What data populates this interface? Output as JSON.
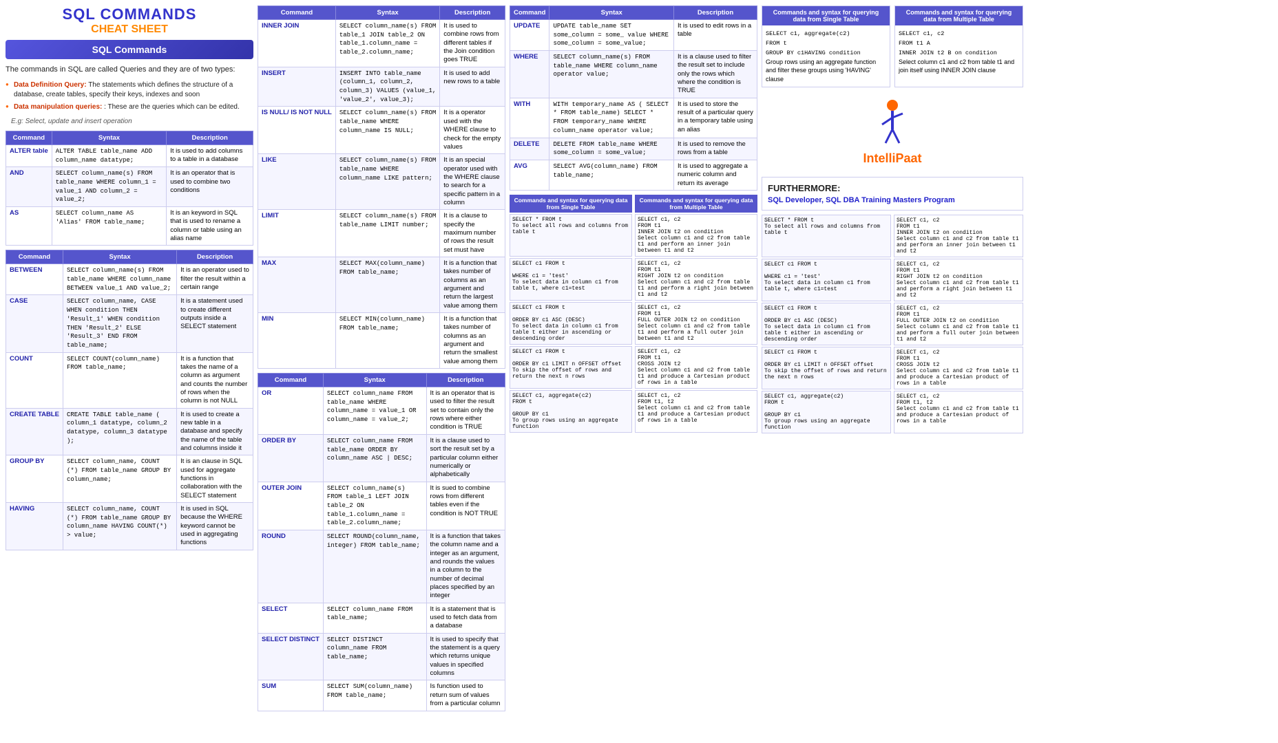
{
  "title": {
    "main": "SQL COMMANDS",
    "sub": "CHEAT SHEET",
    "commands_label": "SQL Commands"
  },
  "intro": {
    "text": "The commands in SQL are called Queries and they are of two types:",
    "bullets": [
      {
        "label": "Data Definition Query:",
        "text": " The statements which defines the structure of a database, create tables, specify their keys, indexes and soon"
      },
      {
        "label": "Data manipulation queries:",
        "text": " : These are the queries which can be edited."
      }
    ],
    "eg": "E.g: Select, update and insert operation"
  },
  "table1": {
    "headers": [
      "Command",
      "Syntax",
      "Description"
    ],
    "rows": [
      {
        "command": "ALTER table",
        "syntax": "ALTER TABLE table_name ADD column_name datatype;",
        "description": "It is used to add columns to a table in a database"
      },
      {
        "command": "AND",
        "syntax": "SELECT column_name(s) FROM table_name WHERE column_1 = value_1 AND column_2 = value_2;",
        "description": "It is an operator that is used to combine two conditions"
      },
      {
        "command": "AS",
        "syntax": "SELECT column_name AS 'Alias' FROM table_name;",
        "description": "It is an keyword in SQL that is used to rename a column or table using an alias name"
      }
    ]
  },
  "table2": {
    "headers": [
      "Command",
      "Syntax",
      "Description"
    ],
    "rows": [
      {
        "command": "BETWEEN",
        "syntax": "SELECT column_name(s) FROM table_name WHERE column_name BETWEEN value_1 AND value_2;",
        "description": "It is an operator used to filter the result within a certain range"
      },
      {
        "command": "CASE",
        "syntax": "SELECT column_name, CASE WHEN condition THEN 'Result_1' WHEN condition THEN 'Result_2' ELSE 'Result_3' END FROM table_name;",
        "description": "It is a statement used to create different outputs inside a SELECT statement"
      },
      {
        "command": "COUNT",
        "syntax": "SELECT COUNT(column_name) FROM table_name;",
        "description": "It is a function that takes the name of a column as argument and counts the number of rows when the column is not NULL"
      },
      {
        "command": "CREATE TABLE",
        "syntax": "CREATE TABLE table_name ( column_1 datatype, column_2 datatype, column_3 datatype );",
        "description": "It is used to create a new table in a database and specify the name of the table and columns inside it"
      },
      {
        "command": "GROUP BY",
        "syntax": "SELECT column_name, COUNT (*) FROM table_name GROUP BY column_name;",
        "description": "It is an clause in SQL used for aggregate functions in collaboration with the SELECT statement"
      },
      {
        "command": "HAVING",
        "syntax": "SELECT column_name, COUNT (*) FROM table_name GROUP BY column_name HAVING COUNT(*) > value;",
        "description": "It is used in SQL because the WHERE keyword cannot be used in aggregating functions"
      }
    ]
  },
  "table3": {
    "headers": [
      "Command",
      "Syntax",
      "Description"
    ],
    "rows": [
      {
        "command": "INNER JOIN",
        "syntax": "SELECT column_name(s) FROM table_1 JOIN table_2 ON table_1.column_name = table_2.column_name;",
        "description": "It is used to combine rows from different tables if the Join condition goes TRUE"
      },
      {
        "command": "INSERT",
        "syntax": "INSERT INTO table_name (column_1, column_2, column_3) VALUES (value_1, 'value_2', value_3);",
        "description": "It is used to add new rows to a table"
      },
      {
        "command": "IS NULL/ IS NOT NULL",
        "syntax": "SELECT column_name(s) FROM table_name WHERE column_name IS NULL;",
        "description": "It is a operator used with the WHERE clause to check for the empty values"
      },
      {
        "command": "LIKE",
        "syntax": "SELECT column_name(s) FROM table_name WHERE column_name LIKE pattern;",
        "description": "It is an special operator used with the WHERE clause to search for a specific pattern in a column"
      },
      {
        "command": "LIMIT",
        "syntax": "SELECT column_name(s) FROM table_name LIMIT number;",
        "description": "It is a clause to specify the maximum number of rows the result set must have"
      },
      {
        "command": "MAX",
        "syntax": "SELECT MAX(column_name) FROM table_name;",
        "description": "It is a function that takes number of columns as an argument and return the largest value among them"
      },
      {
        "command": "MIN",
        "syntax": "SELECT MIN(column_name) FROM table_name;",
        "description": "It is a function that takes number of columns as an argument and return the smallest value among them"
      }
    ]
  },
  "table4": {
    "headers": [
      "Command",
      "Syntax",
      "Description"
    ],
    "rows": [
      {
        "command": "OR",
        "syntax": "SELECT column_name FROM table_name WHERE column_name = value_1 OR column_name = value_2;",
        "description": "It is an operator that is used to filter the result set to contain only the rows where either condition is TRUE"
      },
      {
        "command": "ORDER BY",
        "syntax": "SELECT column_name FROM table_name ORDER BY column_name ASC | DESC;",
        "description": "It is a clause used to sort the result set by a particular column either numerically or alphabetically"
      },
      {
        "command": "OUTER JOIN",
        "syntax": "SELECT column_name(s) FROM table_1 LEFT JOIN table_2 ON table_1.column_name = table_2.column_name;",
        "description": "It is sued to combine rows from different tables even if the condition is NOT TRUE"
      },
      {
        "command": "ROUND",
        "syntax": "SELECT ROUND(column_name, integer) FROM table_name;",
        "description": "It is a function that takes the column name and a integer as an argument, and rounds the values in a column to the number of decimal places specified by an integer"
      },
      {
        "command": "SELECT",
        "syntax": "SELECT column_name FROM table_name;",
        "description": "It is a statement that is used to fetch data from a database"
      },
      {
        "command": "SELECT DISTINCT",
        "syntax": "SELECT DISTINCT column_name FROM table_name;",
        "description": "It is used to specify that the statement is a query which returns unique values in specified columns"
      },
      {
        "command": "SUM",
        "syntax": "SELECT SUM(column_name) FROM table_name;",
        "description": "Is function used to return sum of values from a particular column"
      }
    ]
  },
  "table5": {
    "headers": [
      "Command",
      "Syntax",
      "Description"
    ],
    "rows": [
      {
        "command": "UPDATE",
        "syntax": "UPDATE table_name SET some_column = some_ value WHERE some_column = some_value;",
        "description": "It is used to edit rows in a table"
      },
      {
        "command": "WHERE",
        "syntax": "SELECT column_name(s) FROM table_name WHERE column_name operator value;",
        "description": "It is a clause used to filter the result set to include only the rows which where the condition is TRUE"
      },
      {
        "command": "WITH",
        "syntax": "WITH temporary_name AS ( SELECT * FROM table_name) SELECT * FROM temporary_name WHERE column_name operator value;",
        "description": "It is used to store the result of a particular query in a temporary table using an alias"
      },
      {
        "command": "DELETE",
        "syntax": "DELETE FROM table_name WHERE some_column = some_value;",
        "description": "It is used to remove the rows from a table"
      },
      {
        "command": "AVG",
        "syntax": "SELECT AVG(column_name) FROM table_name;",
        "description": "It is used to aggregate a numeric column and return its average"
      }
    ]
  },
  "query_sections": {
    "single_label": "Commands and syntax for querying data from Single Table",
    "multiple_label": "Commands and syntax for querying data from Multiple Table",
    "pairs": [
      {
        "single": {
          "query": "SELECT * FROM t",
          "desc": "To select all rows and columns from table t"
        },
        "multiple": {
          "query": "SELECT c1, c2\nFROM t1\nINNER JOIN t2 on condition\nSelect column c1 and c2 from table t1 and perform an inner join between t1 and t2"
        }
      },
      {
        "single": {
          "query": "SELECT c1 FROM t\n\nWHERE c1 = 'test'\nTo select data in column c1 from table t, where c1=test"
        },
        "multiple": {
          "query": "SELECT c1, c2\nFROM t1\nRIGHT JOIN t2 on condition\nSelect column c1 and c2 from table t1 and perform a right join between t1 and t2"
        }
      },
      {
        "single": {
          "query": "SELECT c1 FROM t\n\nORDER BY c1 ASC (DESC)\nTo select data in column c1 from table t either in ascending or descending order"
        },
        "multiple": {
          "query": "SELECT c1, c2\nFROM t1\nFULL OUTER JOIN t2 on condition\nSelect column c1 and c2 from table t1 and perform a full outer join between t1 and t2"
        }
      },
      {
        "single": {
          "query": "SELECT c1 FROM t\n\nORDER BY c1 LIMIT n OFFSET offset\nTo skip the offset of rows and return the next n rows"
        },
        "multiple": {
          "query": "SELECT c1, c2\nFROM t1\nCROSS JOIN t2\nSelect column c1 and c2 from table t1 and produce a Cartesian product of rows in a table"
        }
      },
      {
        "single": {
          "query": "SELECT c1, aggregate(c2)\nFROM t\n\nGROUP BY c1\nTo group rows using an aggregate function"
        },
        "multiple": {
          "query": "SELECT c1, c2\nFROM t1, t2\nSelect column c1 and c2 from table t1 and produce a Cartesian product of rows in a table"
        }
      }
    ]
  },
  "top_right": {
    "single_label": "Commands and syntax for querying data from Single Table",
    "multiple_label": "Commands and syntax for querying data from Multiple Table",
    "single_content": "SELECT c1, aggregate(c2)\nFROM t\nGROUP BY c1HAVING condition\nGroup rows using an aggregate function and filter these groups using 'HAVING' clause",
    "multiple_content": "SELECT c1, c2\nFROM t1 A\nINNER JOIN t2 B on condition\nSelect column c1 and c2 from table t1 and join itself using INNER JOIN clause"
  },
  "furthermore": {
    "label": "FURTHERMORE:",
    "link": "SQL Developer, SQL DBA Training Masters Program"
  },
  "logo": {
    "text_part1": "ntelliPaat",
    "text_i": "I"
  }
}
